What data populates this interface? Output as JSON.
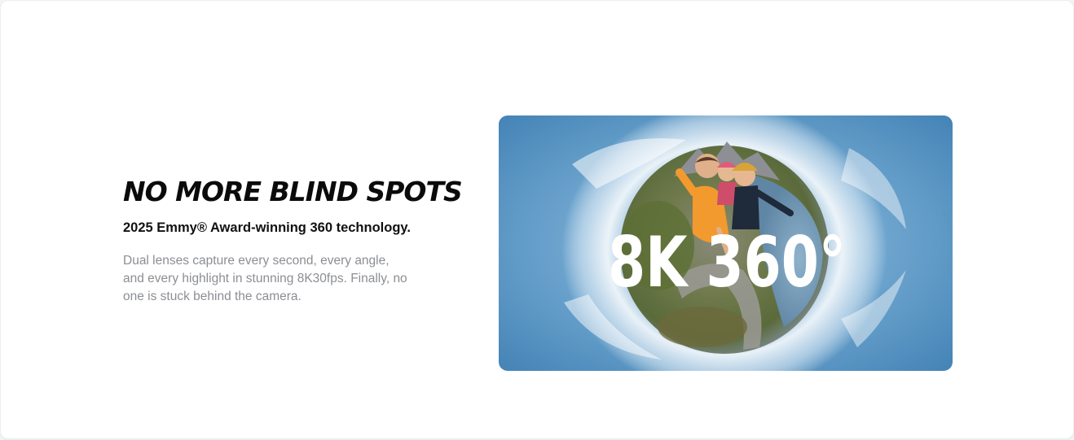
{
  "feature": {
    "headline": "NO MORE BLIND SPOTS",
    "subheadline": "2025 Emmy® Award-winning 360 technology.",
    "description": "Dual lenses capture every second, every angle, and every highlight in stunning 8K30fps. Finally, no one is stuck behind the camera."
  },
  "hero_image": {
    "overlay_text": "8K 360°",
    "subject": "tiny-planet selfie of three people on a mountain road",
    "colors": {
      "sky": "#5f9ccb",
      "cloud": "#f2f7fb",
      "land": "#6f7a4c"
    }
  }
}
